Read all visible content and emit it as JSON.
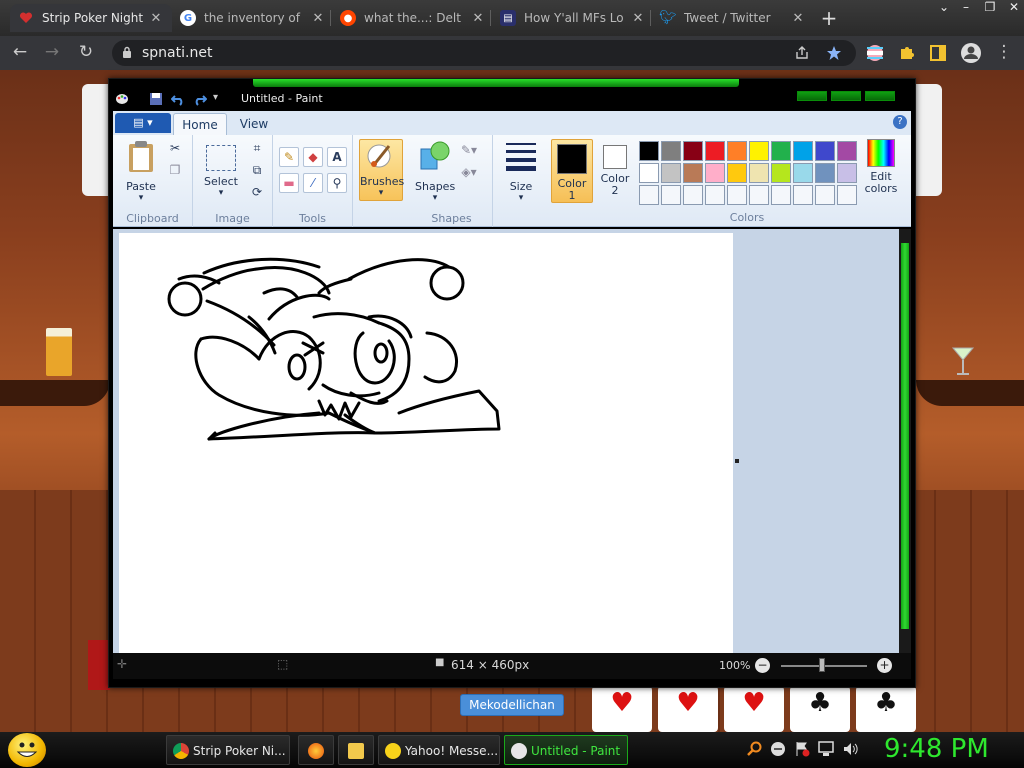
{
  "browser": {
    "tabs": [
      {
        "title": "Strip Poker Night",
        "icon": "heart-icon",
        "color": "#d32f2f",
        "active": true
      },
      {
        "title": "the inventory of",
        "icon": "google-icon",
        "color": "#ffffff",
        "active": false
      },
      {
        "title": "what the...: Delt",
        "icon": "reddit-icon",
        "color": "#ff4500",
        "active": false
      },
      {
        "title": "How Y'all MFs Lo",
        "icon": "page-icon",
        "color": "#2a2f6b",
        "active": false
      },
      {
        "title": "Tweet / Twitter",
        "icon": "twitter-icon",
        "color": "#1d9bf0",
        "active": false
      }
    ],
    "url": "spnati.net"
  },
  "game": {
    "player_name": "Mekodellichan",
    "cards": [
      "♥",
      "♥",
      "♥",
      "♣",
      "♣"
    ]
  },
  "paint": {
    "window_title": "Untitled - Paint",
    "ribbon_tabs": [
      "Home",
      "View"
    ],
    "groups": {
      "clipboard": {
        "label": "Clipboard",
        "paste": "Paste"
      },
      "image": {
        "label": "Image",
        "select": "Select"
      },
      "tools": {
        "label": "Tools"
      },
      "brushes": "Brushes",
      "shapes": {
        "label": "Shapes",
        "shapes": "Shapes"
      },
      "size": "Size",
      "colors": {
        "label": "Colors",
        "color1": "Color 1",
        "color2": "Color 2",
        "edit": "Edit colors"
      }
    },
    "palette": [
      "#000000",
      "#7f7f7f",
      "#880015",
      "#ed1c24",
      "#ff7f27",
      "#fff200",
      "#22b14c",
      "#00a2e8",
      "#3f48cc",
      "#a349a4",
      "#ffffff",
      "#c3c3c3",
      "#b97a57",
      "#ffaec9",
      "#ffc90e",
      "#efe4b0",
      "#b5e61d",
      "#99d9ea",
      "#7092be",
      "#c8bfe7"
    ],
    "status": {
      "dimensions": "614 × 460px",
      "zoom": "100%"
    }
  },
  "taskbar": {
    "tasks": [
      {
        "label": "Strip Poker Ni...",
        "icon": "chrome-icon",
        "active": false
      },
      {
        "label": "",
        "icon": "firefox-icon",
        "active": false
      },
      {
        "label": "",
        "icon": "folder-icon",
        "active": false
      },
      {
        "label": "Yahoo! Messe...",
        "icon": "yahoo-smiley-icon",
        "active": false
      },
      {
        "label": "Untitled - Paint",
        "icon": "paint-icon",
        "active": true
      }
    ],
    "clock": "9:48 PM"
  }
}
